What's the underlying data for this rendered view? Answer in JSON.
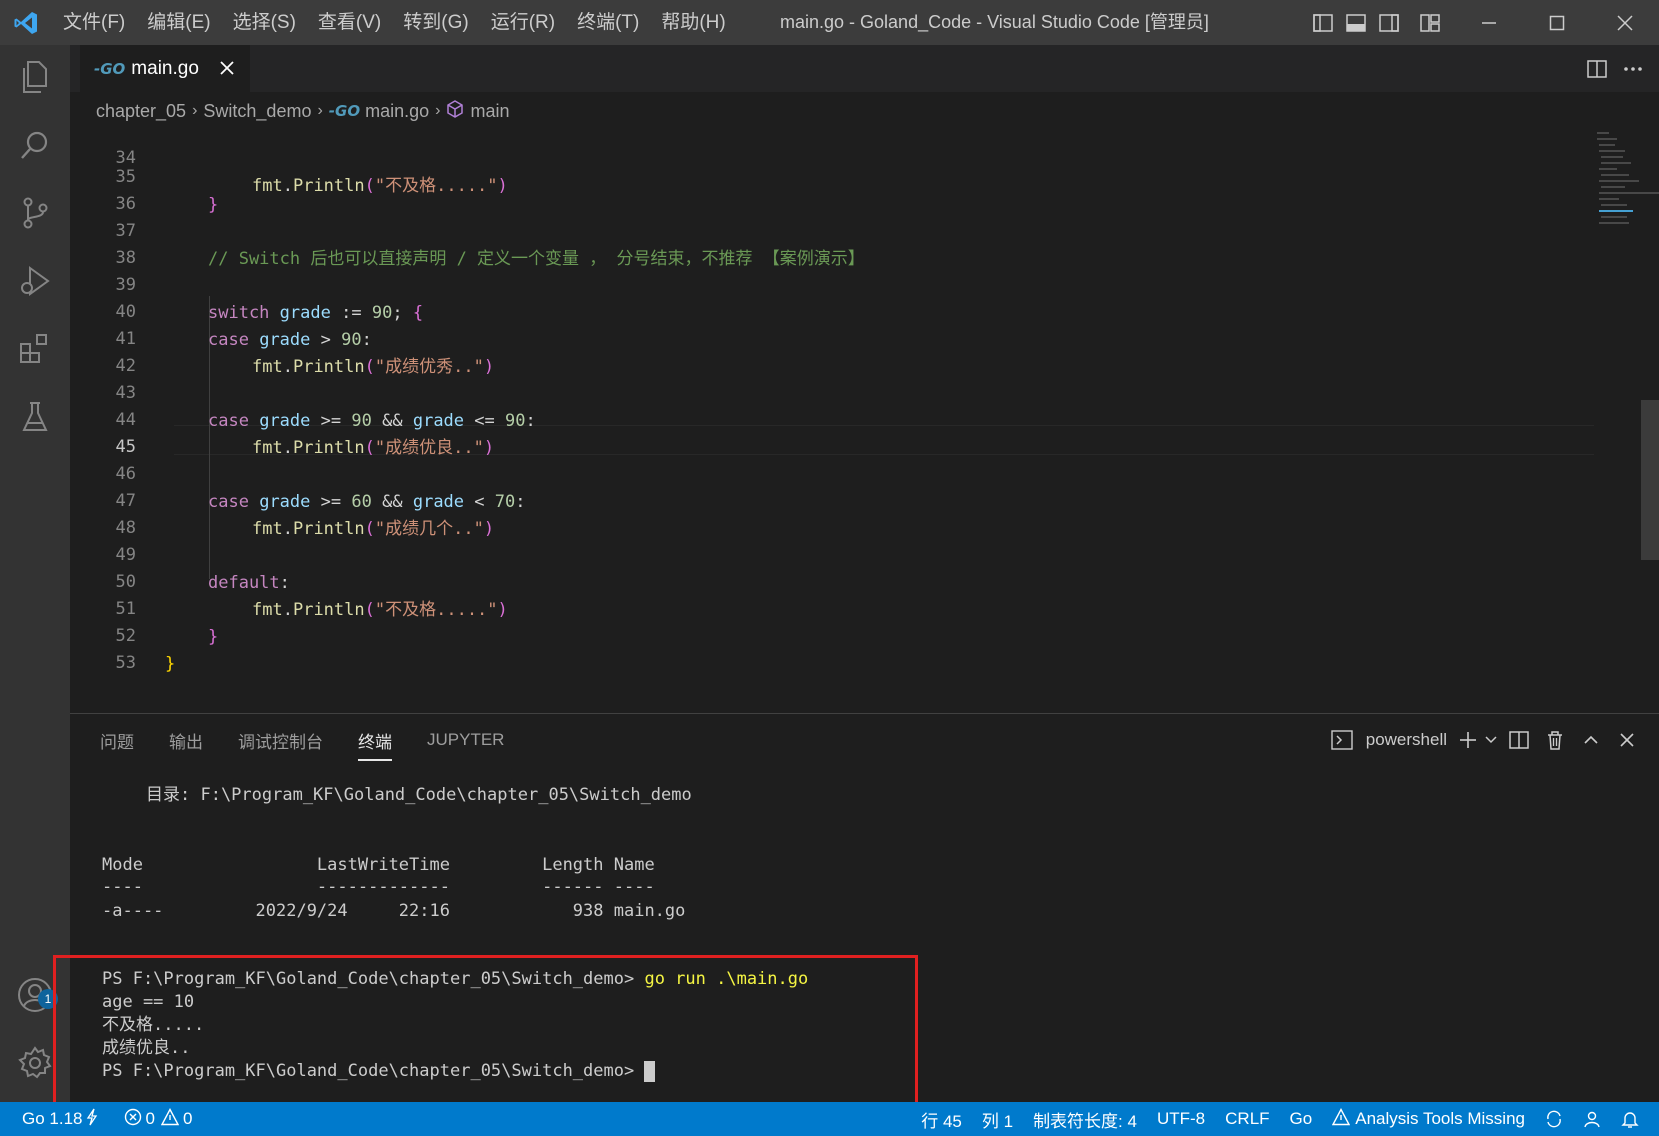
{
  "titlebar": {
    "menu": [
      "文件(F)",
      "编辑(E)",
      "选择(S)",
      "查看(V)",
      "转到(G)",
      "运行(R)",
      "终端(T)",
      "帮助(H)"
    ],
    "window_title": "main.go - Goland_Code - Visual Studio Code [管理员]"
  },
  "tabs": [
    {
      "label": "main.go",
      "icon": "go-file-icon"
    }
  ],
  "breadcrumb": {
    "folder1": "chapter_05",
    "folder2": "Switch_demo",
    "file": "main.go",
    "symbol": "main"
  },
  "editor": {
    "active_line": 45,
    "lines": [
      {
        "n": "34",
        "partial": true
      },
      {
        "n": "35"
      },
      {
        "n": "36"
      },
      {
        "n": "37",
        "comment": "// Switch 后也可以直接声明 / 定义一个变量 ， 分号结束，不推荐 【案例演示】"
      },
      {
        "n": "38"
      },
      {
        "n": "39"
      },
      {
        "n": "40"
      },
      {
        "n": "41",
        "str": "\"成绩优秀..\""
      },
      {
        "n": "42"
      },
      {
        "n": "43"
      },
      {
        "n": "44",
        "str": "\"成绩优良..\""
      },
      {
        "n": "45"
      },
      {
        "n": "46"
      },
      {
        "n": "47",
        "str": "\"成绩几个..\""
      },
      {
        "n": "48"
      },
      {
        "n": "49"
      },
      {
        "n": "50",
        "str": "\"不及格.....\""
      },
      {
        "n": "51"
      },
      {
        "n": "52"
      },
      {
        "n": "53"
      }
    ]
  },
  "panel": {
    "tabs": [
      "问题",
      "输出",
      "调试控制台",
      "终端",
      "JUPYTER"
    ],
    "active_tab": "终端",
    "shell": "powershell",
    "terminal": {
      "dir_line": "目录: F:\\Program_KF\\Goland_Code\\chapter_05\\Switch_demo",
      "header": "Mode                 LastWriteTime         Length Name",
      "rule": "----                 -------------         ------ ----",
      "file_row": "-a----         2022/9/24     22:16            938 main.go",
      "prompt": "PS F:\\Program_KF\\Goland_Code\\chapter_05\\Switch_demo>",
      "command": "go run .\\main.go",
      "output": [
        "age == 10",
        "不及格.....",
        "成绩优良.."
      ],
      "prompt2": "PS F:\\Program_KF\\Goland_Code\\chapter_05\\Switch_demo>"
    }
  },
  "statusbar": {
    "go_version": "Go 1.18",
    "errors": "0",
    "warnings": "0",
    "line": "行 45",
    "col": "列 1",
    "tab_size": "制表符长度: 4",
    "encoding": "UTF-8",
    "eol": "CRLF",
    "language": "Go",
    "analysis": "Analysis Tools Missing"
  },
  "activity": {
    "accounts_badge": "1"
  },
  "colors": {
    "accent": "#007acc",
    "highlight_box": "#e02020"
  }
}
